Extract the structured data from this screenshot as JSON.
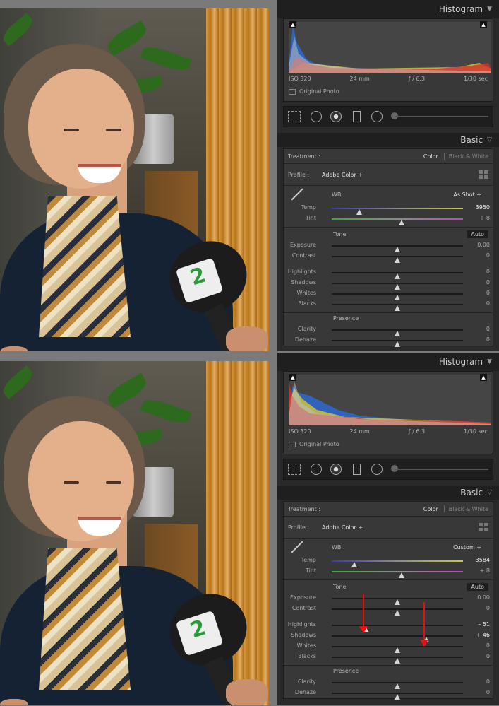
{
  "views": [
    {
      "histogram": {
        "title": "Histogram",
        "iso": "ISO 320",
        "focal": "24 mm",
        "aperture": "ƒ / 6.3",
        "shutter": "1/30 sec",
        "original_photo": "Original Photo"
      },
      "basic": {
        "title": "Basic",
        "treatment_label": "Treatment :",
        "treatment_color": "Color",
        "treatment_bw": "Black & White",
        "profile_label": "Profile :",
        "profile_value": "Adobe Color ÷",
        "wb_label": "WB :",
        "wb_value": "As Shot ÷",
        "temp": {
          "label": "Temp",
          "value": "3950",
          "pos": 0.21
        },
        "tint": {
          "label": "Tint",
          "value": "+ 8",
          "pos": 0.53
        },
        "tone_label": "Tone",
        "auto_label": "Auto",
        "exposure": {
          "label": "Exposure",
          "value": "0.00",
          "pos": 0.5
        },
        "contrast": {
          "label": "Contrast",
          "value": "0",
          "pos": 0.5
        },
        "highlights": {
          "label": "Highlights",
          "value": "0",
          "pos": 0.5
        },
        "shadows": {
          "label": "Shadows",
          "value": "0",
          "pos": 0.5
        },
        "whites": {
          "label": "Whites",
          "value": "0",
          "pos": 0.5
        },
        "blacks": {
          "label": "Blacks",
          "value": "0",
          "pos": 0.5
        },
        "presence_label": "Presence",
        "clarity": {
          "label": "Clarity",
          "value": "0",
          "pos": 0.5
        },
        "dehaze": {
          "label": "Dehaze",
          "value": "0",
          "pos": 0.5
        }
      }
    },
    {
      "histogram": {
        "title": "Histogram",
        "iso": "ISO 320",
        "focal": "24 mm",
        "aperture": "ƒ / 6.3",
        "shutter": "1/30 sec",
        "original_photo": "Original Photo"
      },
      "basic": {
        "title": "Basic",
        "treatment_label": "Treatment :",
        "treatment_color": "Color",
        "treatment_bw": "Black & White",
        "profile_label": "Profile :",
        "profile_value": "Adobe Color ÷",
        "wb_label": "WB :",
        "wb_value": "Custom ÷",
        "temp": {
          "label": "Temp",
          "value": "3584",
          "pos": 0.17
        },
        "tint": {
          "label": "Tint",
          "value": "+ 8",
          "pos": 0.53
        },
        "tone_label": "Tone",
        "auto_label": "Auto",
        "exposure": {
          "label": "Exposure",
          "value": "0.00",
          "pos": 0.5
        },
        "contrast": {
          "label": "Contrast",
          "value": "0",
          "pos": 0.5
        },
        "highlights": {
          "label": "Highlights",
          "value": "– 51",
          "pos": 0.26
        },
        "shadows": {
          "label": "Shadows",
          "value": "+ 46",
          "pos": 0.72
        },
        "whites": {
          "label": "Whites",
          "value": "0",
          "pos": 0.5
        },
        "blacks": {
          "label": "Blacks",
          "value": "0",
          "pos": 0.5
        },
        "presence_label": "Presence",
        "clarity": {
          "label": "Clarity",
          "value": "0",
          "pos": 0.5
        },
        "dehaze": {
          "label": "Dehaze",
          "value": "0",
          "pos": 0.5
        }
      }
    }
  ],
  "colors": {
    "panel_bg": "#2a2a2a",
    "section_bg": "#383838",
    "arrow": "#e11111"
  }
}
